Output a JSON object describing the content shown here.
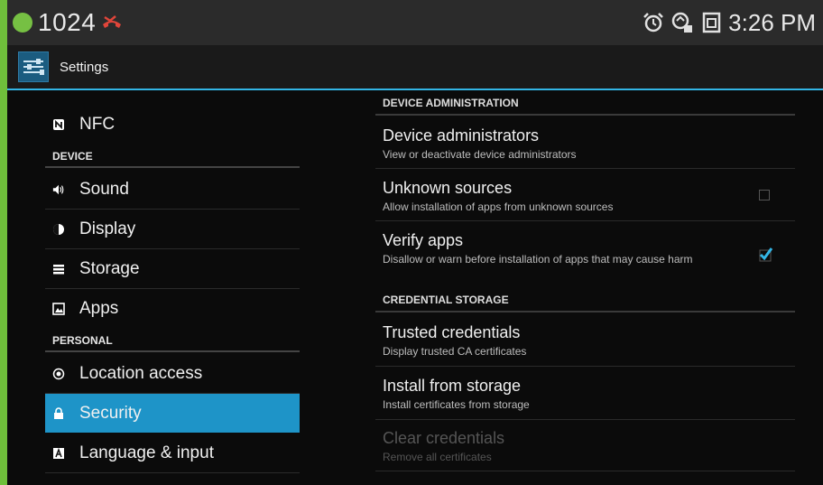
{
  "status_bar": {
    "number": "1024",
    "time": "3:26 PM",
    "icons": [
      "alarm-icon",
      "sync-icon",
      "screenshot-icon"
    ]
  },
  "action_bar": {
    "title": "Settings"
  },
  "sidebar": {
    "items": [
      {
        "type": "item",
        "label": "NFC",
        "icon": "nfc-icon"
      },
      {
        "type": "header",
        "label": "DEVICE"
      },
      {
        "type": "item",
        "label": "Sound",
        "icon": "sound-icon"
      },
      {
        "type": "item",
        "label": "Display",
        "icon": "display-icon"
      },
      {
        "type": "item",
        "label": "Storage",
        "icon": "storage-icon"
      },
      {
        "type": "item",
        "label": "Apps",
        "icon": "apps-icon"
      },
      {
        "type": "header",
        "label": "PERSONAL"
      },
      {
        "type": "item",
        "label": "Location access",
        "icon": "location-icon"
      },
      {
        "type": "item",
        "label": "Security",
        "icon": "lock-icon",
        "selected": true
      },
      {
        "type": "item",
        "label": "Language & input",
        "icon": "language-icon"
      }
    ]
  },
  "content": {
    "sections": [
      {
        "header": "DEVICE ADMINISTRATION",
        "items": [
          {
            "title": "Device administrators",
            "subtitle": "View or deactivate device administrators"
          },
          {
            "title": "Unknown sources",
            "subtitle": "Allow installation of apps from unknown sources",
            "checked": false
          },
          {
            "title": "Verify apps",
            "subtitle": "Disallow or warn before installation of apps that may cause harm",
            "checked": true
          }
        ]
      },
      {
        "header": "CREDENTIAL STORAGE",
        "items": [
          {
            "title": "Trusted credentials",
            "subtitle": "Display trusted CA certificates"
          },
          {
            "title": "Install from storage",
            "subtitle": "Install certificates from storage"
          },
          {
            "title": "Clear credentials",
            "subtitle": "Remove all certificates",
            "disabled": true
          }
        ]
      }
    ]
  },
  "colors": {
    "accent": "#33b5e5",
    "selected": "#1e94c8",
    "status_dot": "#76c043",
    "call_icon": "#e0453a"
  }
}
